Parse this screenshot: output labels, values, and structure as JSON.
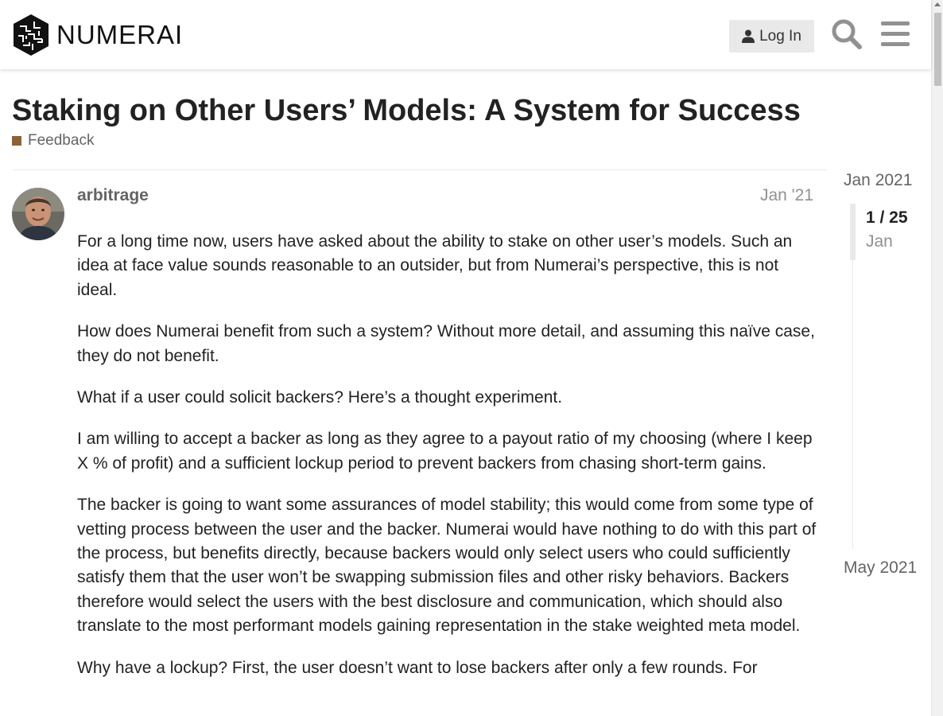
{
  "header": {
    "brand": "NUMERAI",
    "login_label": "Log In"
  },
  "topic": {
    "title": "Staking on Other Users’ Models: A System for Success",
    "category": "Feedback",
    "category_color": "#8c6238"
  },
  "post": {
    "username": "arbitrage",
    "date": "Jan '21",
    "paragraphs": [
      "For a long time now, users have asked about the ability to stake on other user’s models. Such an idea at face value sounds reasonable to an outsider, but from Numerai’s perspective, this is not ideal.",
      "How does Numerai benefit from such a system? Without more detail, and assuming this naïve case, they do not benefit.",
      "What if a user could solicit backers? Here’s a thought experiment.",
      "I am willing to accept a backer as long as they agree to a payout ratio of my choosing (where I keep X % of profit) and a sufficient lockup period to prevent backers from chasing short-term gains.",
      "The backer is going to want some assurances of model stability; this would come from some type of vetting process between the user and the backer. Numerai would have nothing to do with this part of the process, but benefits directly, because backers would only select users who could sufficiently satisfy them that the user won’t be swapping submission files and other risky behaviors. Backers therefore would select the users with the best disclosure and communication, which should also translate to the most performant models gaining representation in the stake weighted meta model.",
      "Why have a lockup? First, the user doesn’t want to lose backers after only a few rounds. For"
    ]
  },
  "timeline": {
    "start_label": "Jan 2021",
    "position": "1 / 25",
    "position_date": "Jan",
    "end_label": "May 2021"
  },
  "icons": {
    "logo": "numerai-logo-icon",
    "user": "user-icon",
    "search": "search-icon",
    "menu": "hamburger-menu-icon"
  }
}
